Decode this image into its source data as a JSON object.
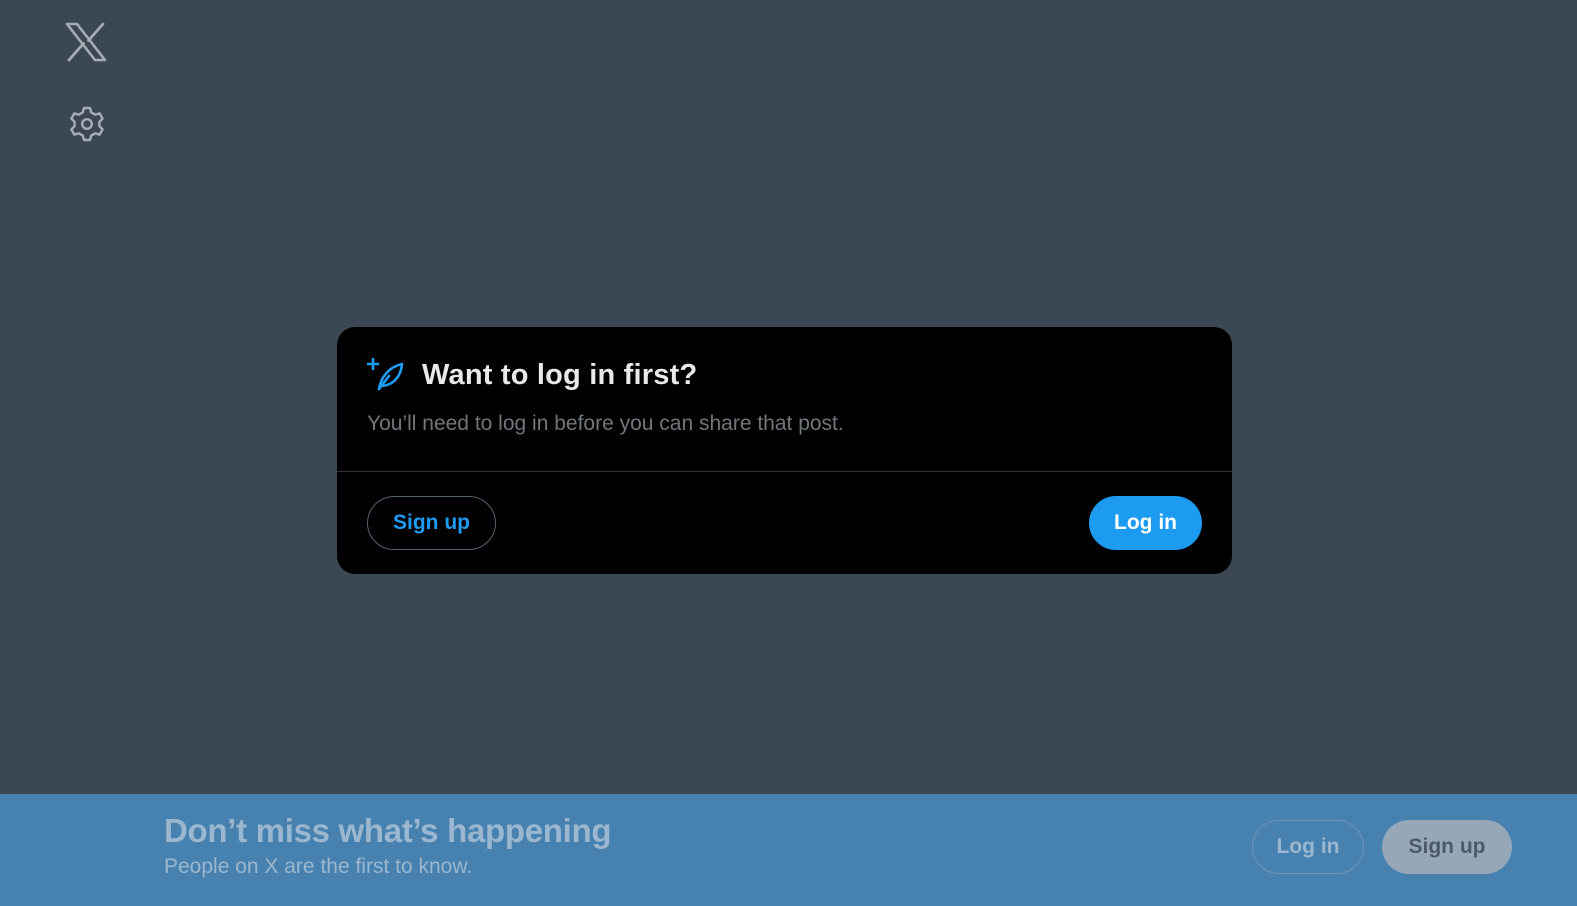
{
  "dialog": {
    "title": "Want to log in first?",
    "text": "You’ll need to log in before you can share that post.",
    "signup_label": "Sign up",
    "login_label": "Log in"
  },
  "banner": {
    "title": "Don’t miss what’s happening",
    "subtitle": "People on X are the first to know.",
    "login_label": "Log in",
    "signup_label": "Sign up"
  },
  "icons": {
    "logo": "x-logo-icon",
    "settings": "gear-icon",
    "dialog": "feather-plus-icon"
  },
  "colors": {
    "accent": "#1d9bf0",
    "overlay": "#3b4853",
    "banner": "#4681b0"
  }
}
